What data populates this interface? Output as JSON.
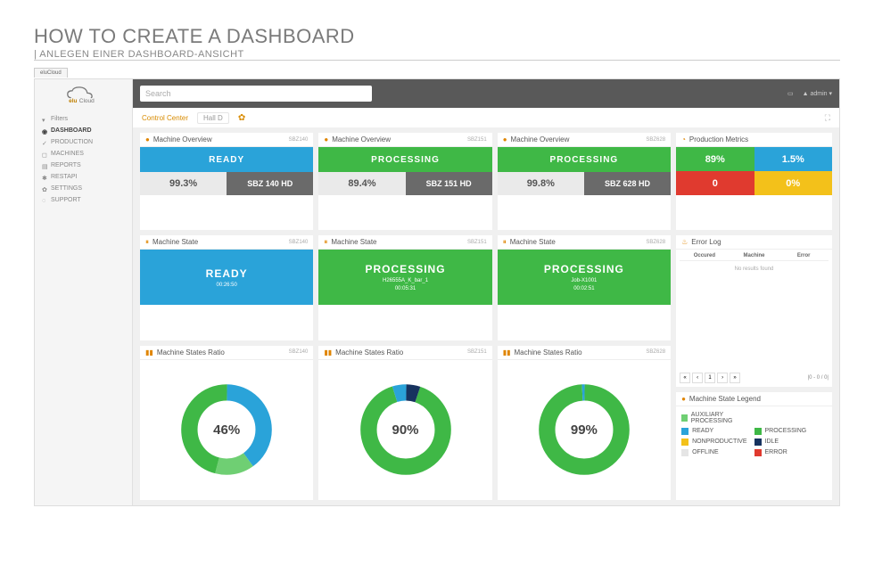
{
  "header": {
    "title": "HOW TO CREATE A DASHBOARD",
    "subtitle": "| ANLEGEN EINER DASHBOARD-ANSICHT",
    "mini_tab": "eluCloud"
  },
  "logo_text": "eluCloud",
  "sidebar": {
    "items": [
      {
        "label": "Filters"
      },
      {
        "label": "DASHBOARD"
      },
      {
        "label": "PRODUCTION"
      },
      {
        "label": "MACHINES"
      },
      {
        "label": "REPORTS"
      },
      {
        "label": "RESTAPI"
      },
      {
        "label": "SETTINGS"
      },
      {
        "label": "SUPPORT"
      }
    ]
  },
  "search": {
    "placeholder": "Search"
  },
  "topbar": {
    "user": "admin"
  },
  "subheader": {
    "control_center": "Control Center",
    "hall": "Hall D"
  },
  "overview": [
    {
      "title": "Machine Overview",
      "code": "SBZ140",
      "status": "READY",
      "pct": "99.3%",
      "model": "SBZ 140 HD"
    },
    {
      "title": "Machine Overview",
      "code": "SBZ151",
      "status": "PROCESSING",
      "pct": "89.4%",
      "model": "SBZ 151 HD"
    },
    {
      "title": "Machine Overview",
      "code": "SBZ628",
      "status": "PROCESSING",
      "pct": "99.8%",
      "model": "SBZ 628 HD"
    }
  ],
  "metrics": {
    "title": "Production Metrics",
    "cells": [
      "89%",
      "1.5%",
      "0",
      "0%"
    ]
  },
  "state": [
    {
      "title": "Machine State",
      "code": "SBZ140",
      "status": "READY",
      "line1": "00:26:50",
      "line2": ""
    },
    {
      "title": "Machine State",
      "code": "SBZ151",
      "status": "PROCESSING",
      "line1": "H26555A_K_bar_1",
      "line2": "00:05:31"
    },
    {
      "title": "Machine State",
      "code": "SBZ628",
      "status": "PROCESSING",
      "line1": "Job-X1001",
      "line2": "00:02:51"
    }
  ],
  "errorlog": {
    "title": "Error Log",
    "cols": [
      "Occured",
      "Machine",
      "Error"
    ],
    "empty": "No results found",
    "pageinfo": "|0 - 0 / 0|"
  },
  "ratio": [
    {
      "title": "Machine States Ratio",
      "code": "SBZ140",
      "pct": "46%"
    },
    {
      "title": "Machine States Ratio",
      "code": "SBZ151",
      "pct": "90%"
    },
    {
      "title": "Machine States Ratio",
      "code": "SBZ628",
      "pct": "99%"
    }
  ],
  "legend": {
    "title": "Machine State Legend",
    "items": {
      "aux": "AUXILIARY PROCESSING",
      "ready": "READY",
      "processing": "PROCESSING",
      "nonproductive": "NONPRODUCTIVE",
      "idle": "IDLE",
      "offline": "OFFLINE",
      "error": "ERROR"
    }
  },
  "chart_data": [
    {
      "type": "pie",
      "title": "Machine States Ratio SBZ140",
      "series": [
        {
          "name": "PROCESSING",
          "value": 46,
          "color": "#3fb846"
        },
        {
          "name": "AUXILIARY PROCESSING",
          "value": 14,
          "color": "#6fcf73"
        },
        {
          "name": "READY",
          "value": 40,
          "color": "#2aa3d9"
        }
      ],
      "center_label": "46%"
    },
    {
      "type": "pie",
      "title": "Machine States Ratio SBZ151",
      "series": [
        {
          "name": "PROCESSING",
          "value": 90,
          "color": "#3fb846"
        },
        {
          "name": "IDLE",
          "value": 5,
          "color": "#17335f"
        },
        {
          "name": "READY",
          "value": 5,
          "color": "#2aa3d9"
        }
      ],
      "center_label": "90%"
    },
    {
      "type": "pie",
      "title": "Machine States Ratio SBZ628",
      "series": [
        {
          "name": "PROCESSING",
          "value": 99,
          "color": "#3fb846"
        },
        {
          "name": "READY",
          "value": 1,
          "color": "#2aa3d9"
        }
      ],
      "center_label": "99%"
    }
  ]
}
